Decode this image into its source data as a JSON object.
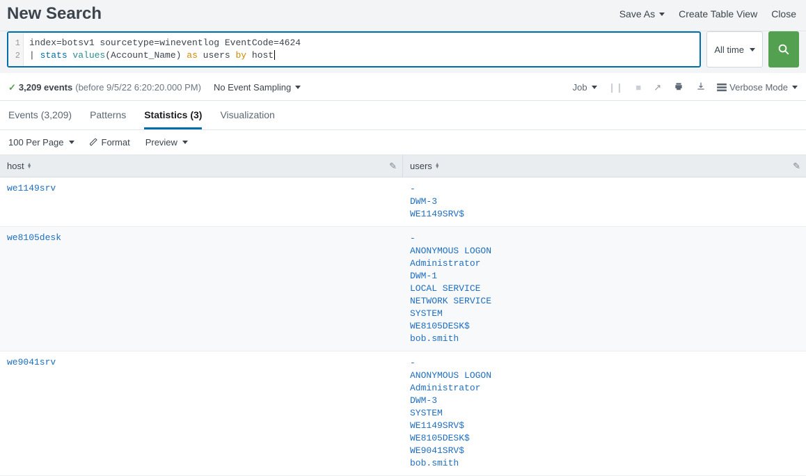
{
  "header": {
    "title": "New Search",
    "actions": {
      "save_as": "Save As",
      "create_table_view": "Create Table View",
      "close": "Close"
    }
  },
  "search": {
    "line1_plain": "index=botsv1 sourcetype=wineventlog EventCode=4624",
    "line2_pipe": "| ",
    "line2_stats": "stats ",
    "line2_values": "values",
    "line2_paren": "(Account_Name) ",
    "line2_as": "as",
    "line2_users": " users ",
    "line2_by": "by",
    "line2_host": " host",
    "gutter1": "1",
    "gutter2": "2",
    "time_label": "All time"
  },
  "status": {
    "event_count": "3,209 events",
    "timestamp": "(before 9/5/22 6:20:20.000 PM)",
    "sampling": "No Event Sampling",
    "job": "Job",
    "mode": "Verbose Mode"
  },
  "tabs": {
    "events": "Events (3,209)",
    "patterns": "Patterns",
    "statistics": "Statistics (3)",
    "visualization": "Visualization"
  },
  "toolbar": {
    "per_page": "100 Per Page",
    "format": "Format",
    "preview": "Preview"
  },
  "table": {
    "col_host": "host",
    "col_users": "users",
    "rows": [
      {
        "host": "we1149srv",
        "users": [
          "-",
          "DWM-3",
          "WE1149SRV$"
        ]
      },
      {
        "host": "we8105desk",
        "users": [
          "-",
          "ANONYMOUS LOGON",
          "Administrator",
          "DWM-1",
          "LOCAL SERVICE",
          "NETWORK SERVICE",
          "SYSTEM",
          "WE8105DESK$",
          "bob.smith"
        ]
      },
      {
        "host": "we9041srv",
        "users": [
          "-",
          "ANONYMOUS LOGON",
          "Administrator",
          "DWM-3",
          "SYSTEM",
          "WE1149SRV$",
          "WE8105DESK$",
          "WE9041SRV$",
          "bob.smith"
        ]
      }
    ]
  }
}
